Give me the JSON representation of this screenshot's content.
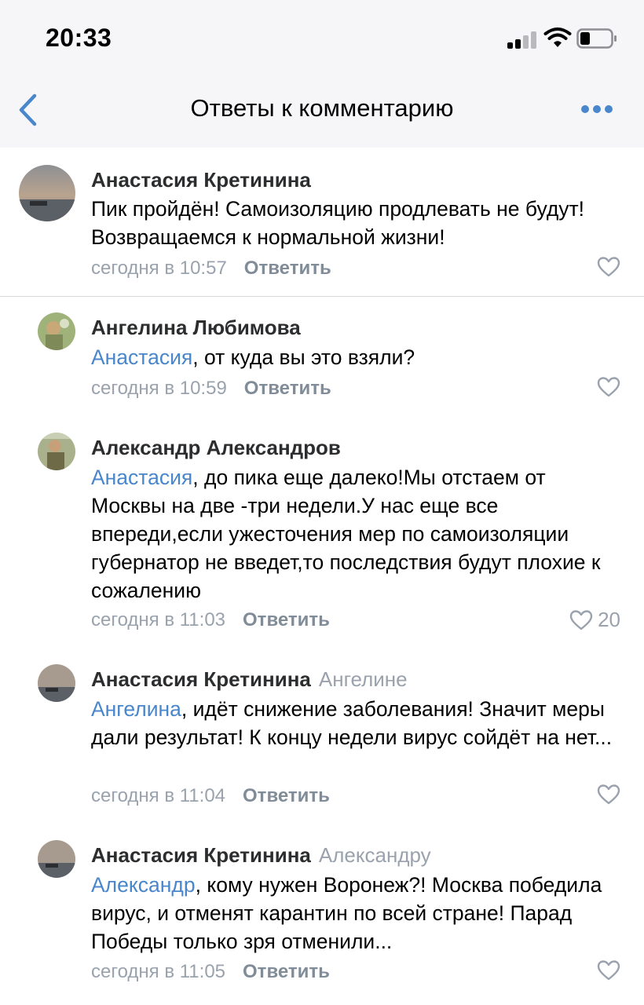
{
  "status_bar": {
    "time": "20:33"
  },
  "nav": {
    "title": "Ответы к комментарию",
    "back_icon": "chevron-left-icon",
    "more_icon": "ellipsis-icon",
    "accent": "#4986cc"
  },
  "comments": [
    {
      "author": "Анастасия Кретинина",
      "reply_to": "",
      "mention": "",
      "text": "Пик пройдён! Самоизоляцию продлевать не будут! Возвращаемся к нормальной жизни!",
      "time": "сегодня в 10:57",
      "reply_label": "Ответить",
      "likes": ""
    },
    {
      "author": "Ангелина Любимова",
      "reply_to": "",
      "mention": "Анастасия",
      "text": ", от куда вы это взяли?",
      "time": "сегодня в 10:59",
      "reply_label": "Ответить",
      "likes": ""
    },
    {
      "author": "Александр Александров",
      "reply_to": "",
      "mention": "Анастасия",
      "text": ", до пика еще далеко!Мы отстаем от Москвы на две -три недели.У нас еще все впереди,если ужесточения мер по самоизоляции губернатор не введет,то последствия будут плохие к сожалению",
      "time": "сегодня в 11:03",
      "reply_label": "Ответить",
      "likes": "20"
    },
    {
      "author": "Анастасия Кретинина",
      "reply_to": "Ангелине",
      "mention": "Ангелина",
      "text": ", идёт снижение заболевания! Значит меры дали результат! К концу недели вирус сойдёт на нет...",
      "time": "сегодня в 11:04",
      "reply_label": "Ответить",
      "likes": ""
    },
    {
      "author": "Анастасия Кретинина",
      "reply_to": "Александру",
      "mention": "Александр",
      "text": ", кому нужен Воронеж?! Москва победила вирус, и отменят карантин по всей стране! Парад Победы только зря отменили...",
      "time": "сегодня в 11:05",
      "reply_label": "Ответить",
      "likes": ""
    }
  ]
}
